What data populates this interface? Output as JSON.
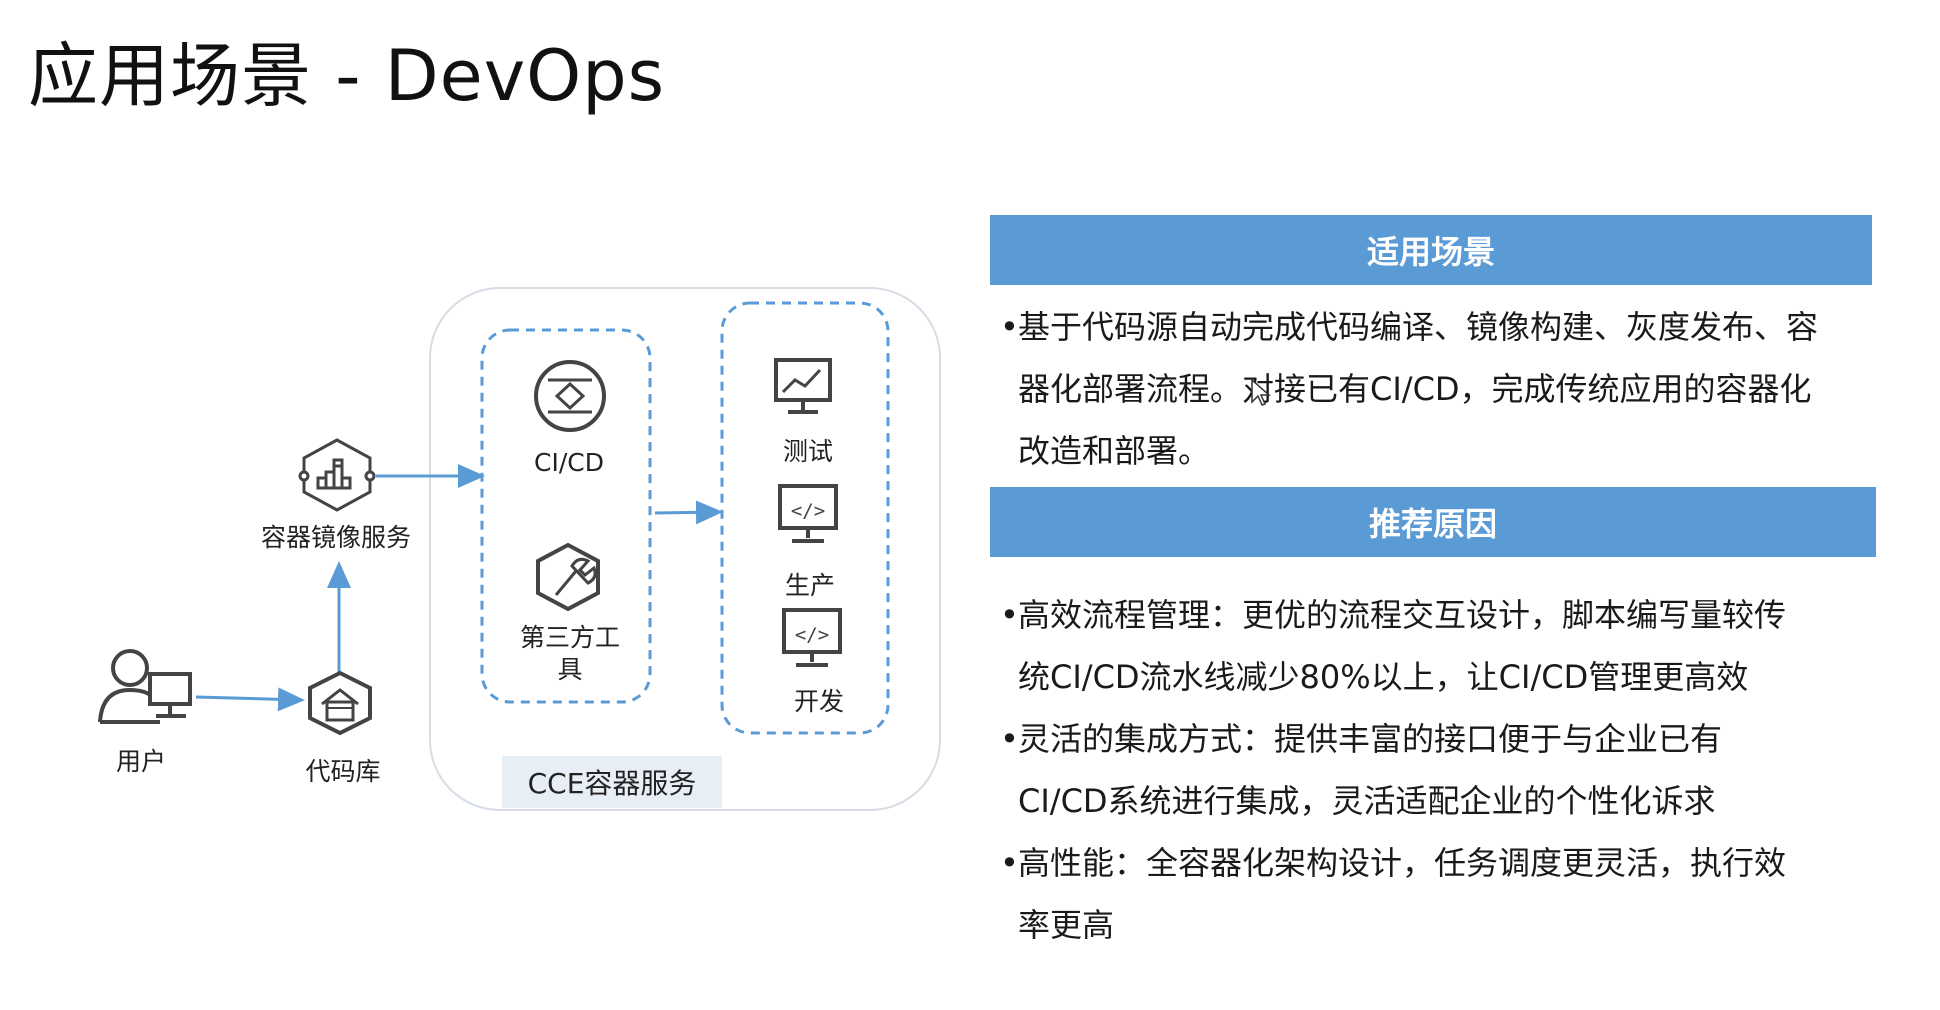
{
  "title": "应用场景 - DevOps",
  "colors": {
    "accent": "#5b9bd5",
    "flow": "#5b9bd5",
    "dashed": "#5b9bd5",
    "icon": "#444444"
  },
  "diagram": {
    "nodes": {
      "user": "用户",
      "code_repo": "代码库",
      "image_service": "容器镜像服务",
      "cicd": "CI/CD",
      "third_party": "第三方工\n具",
      "test": "测试",
      "production": "生产",
      "develop": "开发"
    },
    "container_label": "CCE容器服务"
  },
  "panel": {
    "scenario": {
      "header": "适用场景",
      "text": "基于代码源自动完成代码编译、镜像构建、灰度发布、容\n器化部署流程。对接已有CI/CD，完成传统应用的容器化\n改造和部署。"
    },
    "reasons": {
      "header": "推荐原因",
      "items": [
        "高效流程管理：更优的流程交互设计，脚本编写量较传\n统CI/CD流水线减少80%以上，让CI/CD管理更高效",
        "灵活的集成方式：提供丰富的接口便于与企业已有\nCI/CD系统进行集成，灵活适配企业的个性化诉求",
        "高性能：全容器化架构设计，任务调度更灵活，执行效\n率更高"
      ]
    }
  }
}
